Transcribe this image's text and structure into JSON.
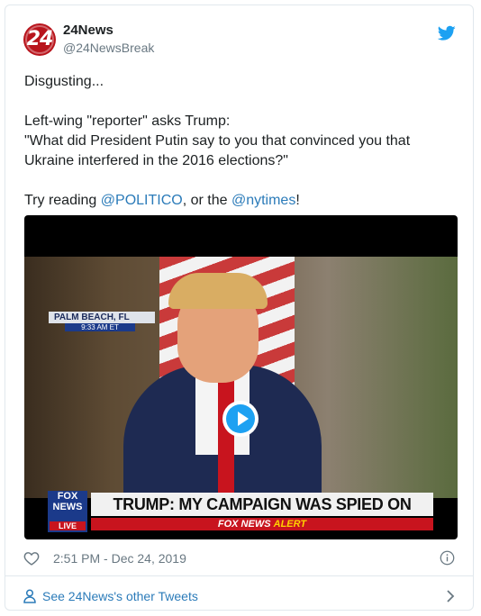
{
  "tweet": {
    "display_name": "24News",
    "handle": "@24NewsBreak",
    "avatar_text": "24",
    "lines": {
      "l1": "Disgusting...",
      "l2": "Left-wing \"reporter\" asks Trump:",
      "l3": "\"What did President Putin say to you that convinced you that Ukraine interfered in the 2016 elections?\"",
      "l4_prefix": "Try reading ",
      "l4_link1": "@POLITICO",
      "l4_mid": ", or the ",
      "l4_link2": "@nytimes",
      "l4_suffix": "!"
    },
    "timestamp": "2:51 PM - Dec 24, 2019"
  },
  "video": {
    "location": "PALM BEACH, FL",
    "time": "9:33 AM ET",
    "logo_line1": "FOX",
    "logo_line2": "NEWS",
    "logo_live": "LIVE",
    "headline": "TRUMP: MY CAMPAIGN WAS SPIED ON",
    "alert_prefix": "FOX NEWS",
    "alert_word": "ALERT"
  },
  "footer": {
    "see_more": "See 24News's other Tweets"
  },
  "colors": {
    "link": "#2b7bb9",
    "twitter_blue": "#1da1f2",
    "secondary_text": "#697882"
  }
}
